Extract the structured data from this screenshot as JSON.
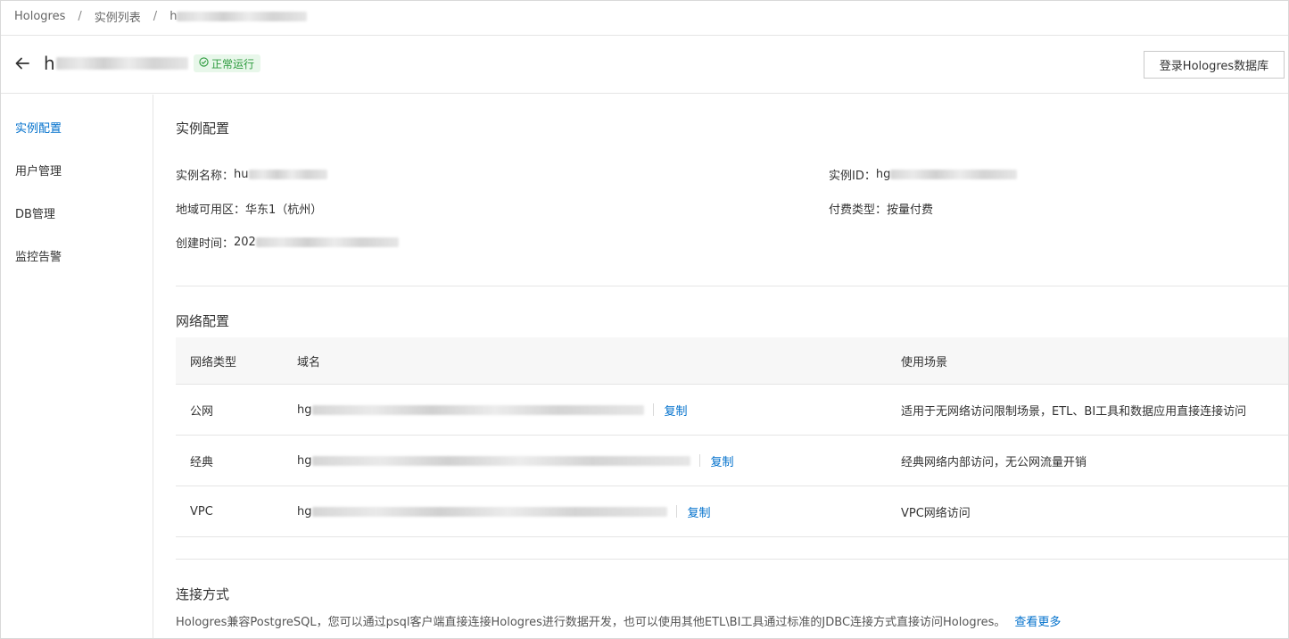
{
  "breadcrumb": {
    "items": [
      "Hologres",
      "实例列表",
      "h"
    ],
    "separator": "/"
  },
  "header": {
    "instance_name_prefix": "h",
    "status_text": "正常运行",
    "login_button": "登录Hologres数据库",
    "back_icon": "arrow-left-icon",
    "status_icon": "check-circle-icon"
  },
  "sidebar": {
    "items": [
      {
        "label": "实例配置",
        "active": true
      },
      {
        "label": "用户管理",
        "active": false
      },
      {
        "label": "DB管理",
        "active": false
      },
      {
        "label": "监控告警",
        "active": false
      }
    ]
  },
  "instance_config": {
    "title": "实例配置",
    "name_label": "实例名称：",
    "name_value_prefix": "hu",
    "id_label": "实例ID：",
    "id_value_prefix": "hg",
    "region_label": "地域可用区：",
    "region_value": "华东1（杭州）",
    "billing_label": "付费类型：",
    "billing_value": "按量付费",
    "created_label": "创建时间：",
    "created_value_prefix": "202"
  },
  "network_config": {
    "title": "网络配置",
    "columns": [
      "网络类型",
      "域名",
      "使用场景"
    ],
    "rows": [
      {
        "type": "公网",
        "domain_prefix": "hg",
        "copy": "复制",
        "usage": "适用于无网络访问限制场景，ETL、BI工具和数据应用直接连接访问"
      },
      {
        "type": "经典",
        "domain_prefix": "hg",
        "copy": "复制",
        "usage": "经典网络内部访问，无公网流量开销"
      },
      {
        "type": "VPC",
        "domain_prefix": "hg",
        "copy": "复制",
        "usage": "VPC网络访问"
      }
    ]
  },
  "connection": {
    "title": "连接方式",
    "description": "Hologres兼容PostgreSQL，您可以通过psql客户端直接连接Hologres进行数据开发，也可以使用其他ETL\\BI工具通过标准的JDBC连接方式直接访问Hologres。",
    "more_link": "查看更多"
  },
  "colors": {
    "accent": "#0070cc",
    "status_bg": "#e8f7ea",
    "status_text": "#2b9a3c"
  }
}
